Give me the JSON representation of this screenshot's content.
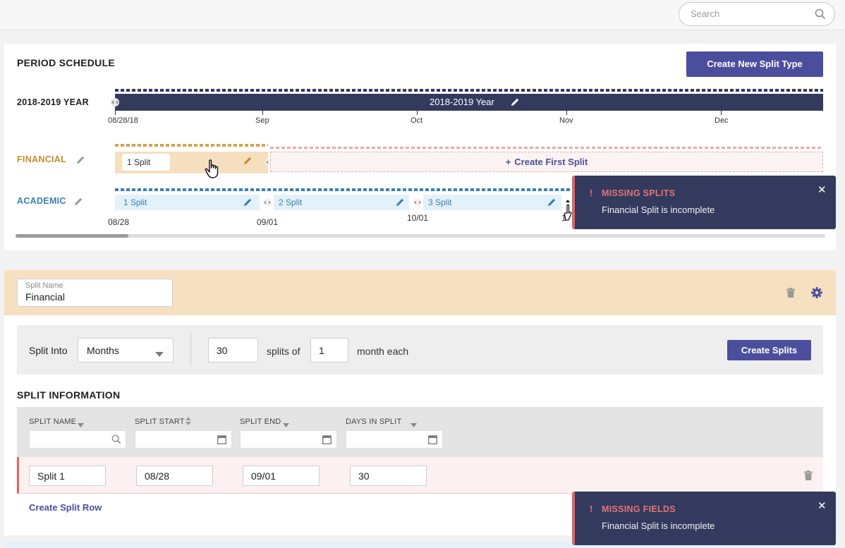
{
  "search": {
    "placeholder": "Search"
  },
  "period_schedule": {
    "title": "PERIOD SCHEDULE",
    "create_button": "Create New Split Type",
    "year_row": {
      "label": "2018-2019 YEAR",
      "bar_label": "2018-2019 Year"
    },
    "axis_ticks": [
      "08/28/18",
      "Sep",
      "Oct",
      "Nov",
      "Dec"
    ],
    "financial_row": {
      "label": "FINANCIAL",
      "pill": "1 Split",
      "create_first": "Create First Split"
    },
    "academic_row": {
      "label": "ACADEMIC",
      "splits": [
        "1 Split",
        "2 Split",
        "3 Split"
      ],
      "dates": [
        "08/28",
        "09/01",
        "10/01",
        "1"
      ]
    }
  },
  "toasts": {
    "splits": {
      "title": "MISSING SPLITS",
      "message": "Financial Split is incomplete"
    },
    "fields": {
      "title": "MISSING FIELDS",
      "message": "Financial Split is incomplete"
    }
  },
  "financial_section": {
    "name_label": "Split Name",
    "name_value": "Financial",
    "split_into_label": "Split Into",
    "split_into_value": "Months",
    "count_value": "30",
    "splits_of_label": "splits of",
    "months_value": "1",
    "month_each_label": "month each",
    "create_splits_button": "Create Splits"
  },
  "split_information": {
    "title": "SPLIT INFORMATION",
    "columns": [
      "SPLIT NAME",
      "SPLIT START",
      "SPLIT END",
      "DAYS IN SPLIT"
    ],
    "rows": [
      {
        "name": "Split 1",
        "start": "08/28",
        "end": "09/01",
        "days": "30"
      }
    ],
    "create_row": "Create Split Row"
  },
  "colors": {
    "primary": "#4a4e9c",
    "financial": "#c88a2e",
    "academic": "#3b7fb4",
    "error": "#e06464",
    "toast_bg": "#333a5e"
  }
}
